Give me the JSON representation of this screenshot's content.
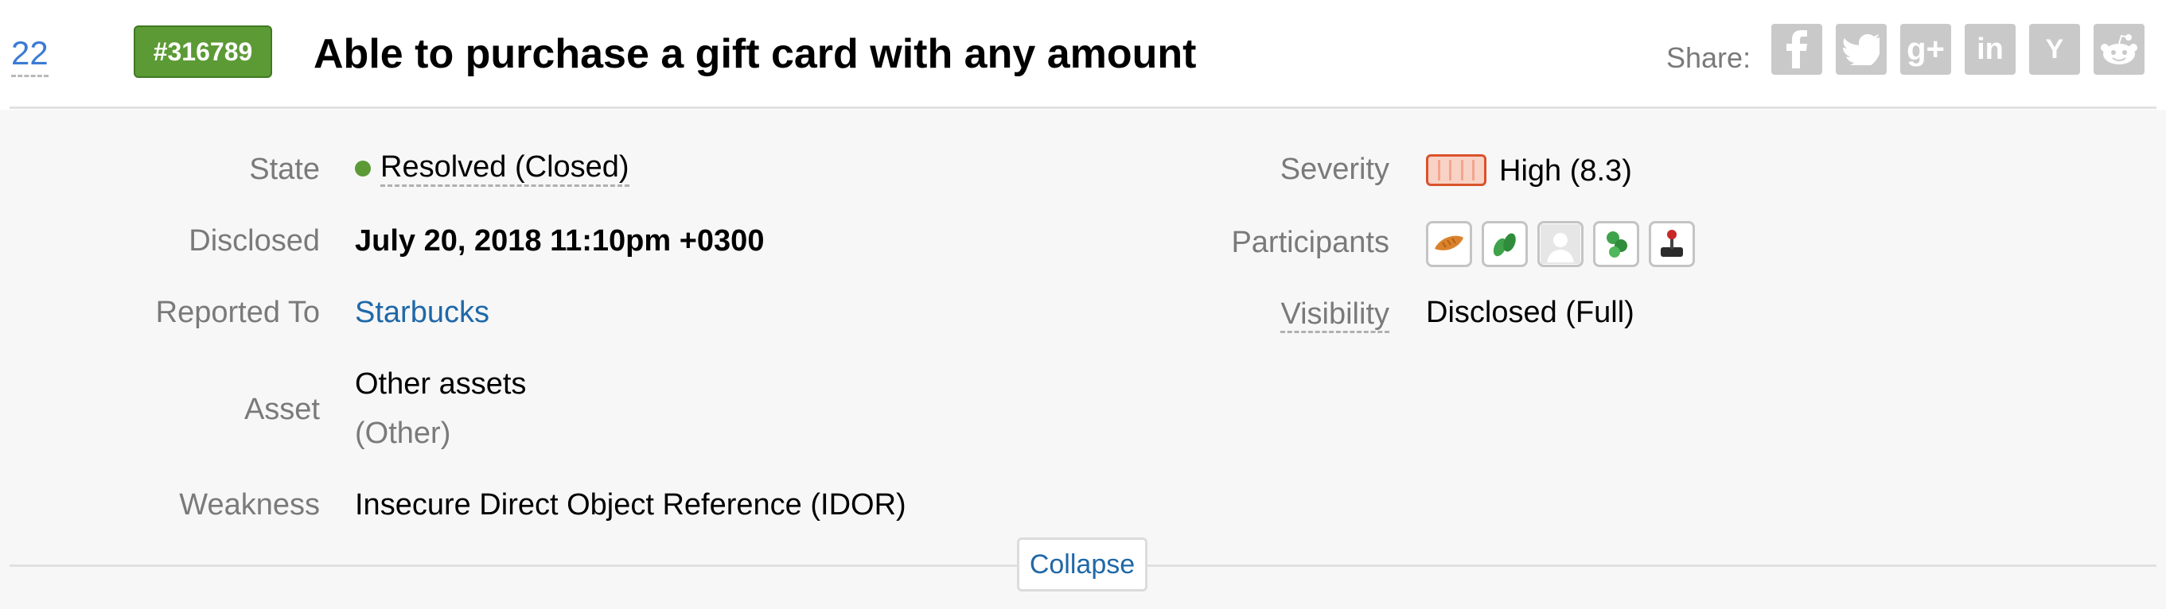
{
  "header": {
    "votes": "22",
    "report_id": "#316789",
    "title": "Able to purchase a gift card with any amount"
  },
  "share": {
    "label": "Share:",
    "buttons": [
      {
        "icon": "facebook-icon",
        "glyph": "f"
      },
      {
        "icon": "twitter-icon",
        "glyph": "🐦"
      },
      {
        "icon": "google-plus-icon",
        "glyph": "g+"
      },
      {
        "icon": "linkedin-icon",
        "glyph": "in"
      },
      {
        "icon": "hacker-news-icon",
        "glyph": "Y"
      },
      {
        "icon": "reddit-icon",
        "glyph": "👽"
      }
    ]
  },
  "details": {
    "state": {
      "label": "State",
      "value": "Resolved (Closed)"
    },
    "disclosed": {
      "label": "Disclosed",
      "value": "July 20, 2018 11:10pm +0300"
    },
    "reported_to": {
      "label": "Reported To",
      "value": "Starbucks"
    },
    "asset": {
      "label": "Asset",
      "value": "Other assets",
      "type": "(Other)"
    },
    "weakness": {
      "label": "Weakness",
      "value": "Insecure Direct Object Reference (IDOR)"
    },
    "severity": {
      "label": "Severity",
      "value": "High (8.3)"
    },
    "participants": {
      "label": "Participants",
      "avatars": [
        "bread-avatar",
        "leaf-avatar",
        "default-user-avatar",
        "green-blob-avatar",
        "joystick-avatar"
      ]
    },
    "visibility": {
      "label": "Visibility",
      "value": "Disclosed (Full)"
    }
  },
  "collapse_label": "Collapse",
  "colors": {
    "resolved": "#5b9a35",
    "severity_high": "#d9532c",
    "link": "#1f68a8"
  }
}
